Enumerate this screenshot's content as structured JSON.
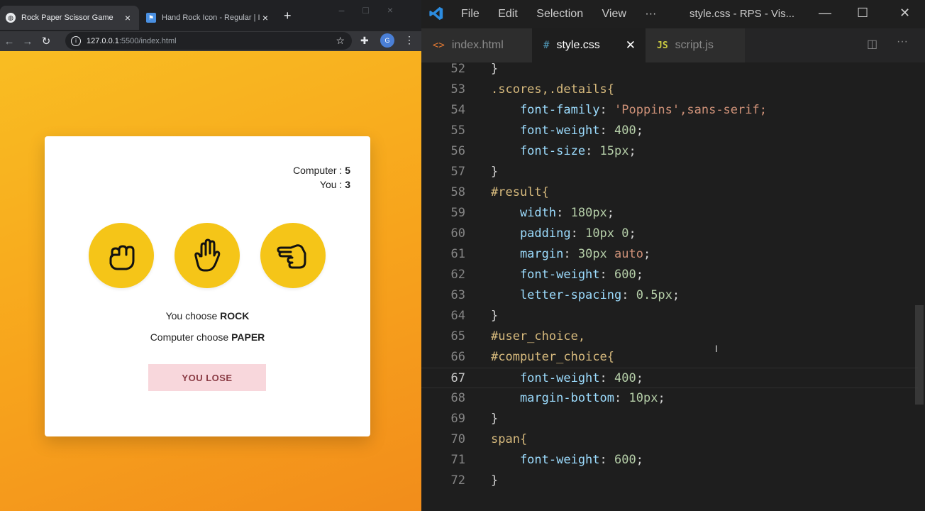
{
  "browser": {
    "tabs": [
      {
        "title": "Rock Paper Scissor Game",
        "icon": "globe-icon"
      },
      {
        "title": "Hand Rock Icon - Regular | I",
        "icon": "flag-icon"
      }
    ],
    "url_host": "127.0.0.1",
    "url_rest": ":5500/index.html",
    "profile_initials": "G"
  },
  "game": {
    "computer_label": "Computer :",
    "computer_score": "5",
    "you_label": "You :",
    "you_score": "3",
    "user_choice_prefix": "You choose",
    "user_choice": "ROCK",
    "computer_choice_prefix": "Computer choose",
    "computer_choice": "PAPER",
    "result": "YOU LOSE",
    "choice_icons": [
      "hand-rock-icon",
      "hand-paper-icon",
      "hand-scissors-icon"
    ],
    "accent": "#f5c518"
  },
  "vscode": {
    "menu": [
      "File",
      "Edit",
      "Selection",
      "View",
      "···"
    ],
    "window_title": "style.css - RPS - Vis...",
    "tabs": [
      {
        "label": "index.html",
        "icon": "<>"
      },
      {
        "label": "style.css",
        "icon": "#"
      },
      {
        "label": "script.js",
        "icon": "JS"
      }
    ],
    "current_line": 67,
    "lines": [
      {
        "n": "52",
        "tokens": [
          [
            "}",
            "t-pun"
          ]
        ]
      },
      {
        "n": "53",
        "tokens": [
          [
            ".scores,.details{",
            "t-sel"
          ]
        ]
      },
      {
        "n": "54",
        "tokens": [
          [
            "    font-family",
            "t-prop"
          ],
          [
            ": ",
            "t-pun"
          ],
          [
            "'Poppins'",
            "t-str"
          ],
          [
            ",sans-serif;",
            "t-kw"
          ]
        ]
      },
      {
        "n": "55",
        "tokens": [
          [
            "    font-weight",
            "t-prop"
          ],
          [
            ": ",
            "t-pun"
          ],
          [
            "400",
            "t-num"
          ],
          [
            ";",
            "t-pun"
          ]
        ]
      },
      {
        "n": "56",
        "tokens": [
          [
            "    font-size",
            "t-prop"
          ],
          [
            ": ",
            "t-pun"
          ],
          [
            "15px",
            "t-num"
          ],
          [
            ";",
            "t-pun"
          ]
        ]
      },
      {
        "n": "57",
        "tokens": [
          [
            "}",
            "t-pun"
          ]
        ]
      },
      {
        "n": "58",
        "tokens": [
          [
            "#result{",
            "t-sel"
          ]
        ]
      },
      {
        "n": "59",
        "tokens": [
          [
            "    width",
            "t-prop"
          ],
          [
            ": ",
            "t-pun"
          ],
          [
            "180px",
            "t-num"
          ],
          [
            ";",
            "t-pun"
          ]
        ]
      },
      {
        "n": "60",
        "tokens": [
          [
            "    padding",
            "t-prop"
          ],
          [
            ": ",
            "t-pun"
          ],
          [
            "10px 0",
            "t-num"
          ],
          [
            ";",
            "t-pun"
          ]
        ]
      },
      {
        "n": "61",
        "tokens": [
          [
            "    margin",
            "t-prop"
          ],
          [
            ": ",
            "t-pun"
          ],
          [
            "30px ",
            "t-num"
          ],
          [
            "auto",
            "t-kw"
          ],
          [
            ";",
            "t-pun"
          ]
        ]
      },
      {
        "n": "62",
        "tokens": [
          [
            "    font-weight",
            "t-prop"
          ],
          [
            ": ",
            "t-pun"
          ],
          [
            "600",
            "t-num"
          ],
          [
            ";",
            "t-pun"
          ]
        ]
      },
      {
        "n": "63",
        "tokens": [
          [
            "    letter-spacing",
            "t-prop"
          ],
          [
            ": ",
            "t-pun"
          ],
          [
            "0.5px",
            "t-num"
          ],
          [
            ";",
            "t-pun"
          ]
        ]
      },
      {
        "n": "64",
        "tokens": [
          [
            "}",
            "t-pun"
          ]
        ]
      },
      {
        "n": "65",
        "tokens": [
          [
            "#user_choice,",
            "t-sel"
          ]
        ]
      },
      {
        "n": "66",
        "tokens": [
          [
            "#computer_choice{",
            "t-sel"
          ]
        ]
      },
      {
        "n": "67",
        "tokens": [
          [
            "    font-weight",
            "t-prop"
          ],
          [
            ": ",
            "t-pun"
          ],
          [
            "400",
            "t-num"
          ],
          [
            ";",
            "t-pun"
          ]
        ]
      },
      {
        "n": "68",
        "tokens": [
          [
            "    margin-bottom",
            "t-prop"
          ],
          [
            ": ",
            "t-pun"
          ],
          [
            "10px",
            "t-num"
          ],
          [
            ";",
            "t-pun"
          ]
        ]
      },
      {
        "n": "69",
        "tokens": [
          [
            "}",
            "t-pun"
          ]
        ]
      },
      {
        "n": "70",
        "tokens": [
          [
            "span{",
            "t-sel"
          ]
        ]
      },
      {
        "n": "71",
        "tokens": [
          [
            "    font-weight",
            "t-prop"
          ],
          [
            ": ",
            "t-pun"
          ],
          [
            "600",
            "t-num"
          ],
          [
            ";",
            "t-pun"
          ]
        ]
      },
      {
        "n": "72",
        "tokens": [
          [
            "}",
            "t-pun"
          ]
        ]
      }
    ]
  }
}
